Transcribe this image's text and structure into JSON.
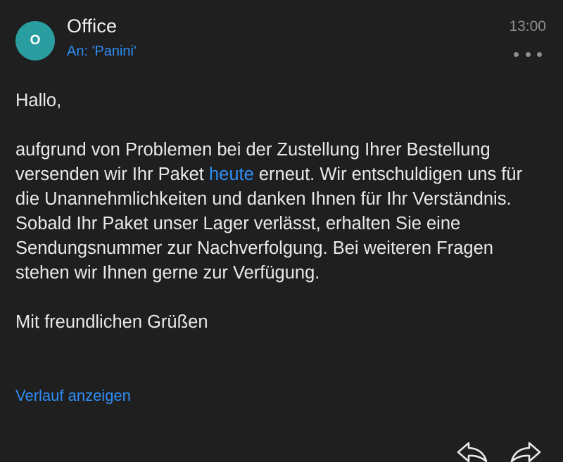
{
  "header": {
    "avatar_initial": "O",
    "sender_name": "Office",
    "recipient": "An: 'Panini'",
    "time": "13:00",
    "more_icon": "more-options-icon"
  },
  "message": {
    "greeting": "Hallo,",
    "para1_before_link": "aufgrund von Problemen bei der Zustellung Ihrer Bestellung versenden wir Ihr Paket ",
    "para1_link": "heute",
    "para1_after_link": " erneut. Wir entschuldigen uns für die Unannehmlichkeiten und danken Ihnen für Ihr Verständnis.",
    "para2": "Sobald Ihr Paket unser Lager verlässt, erhalten Sie eine Sendungsnummer zur Nachverfolgung. Bei weiteren Fragen stehen wir Ihnen gerne zur Verfügung.",
    "closing": "Mit freundlichen Grüßen"
  },
  "footer": {
    "show_history_label": "Verlauf anzeigen",
    "reply_icon": "reply-icon",
    "forward_icon": "forward-icon"
  },
  "colors": {
    "background": "#1f1f1f",
    "text": "#e9e9eb",
    "accent_link": "#2f8df5",
    "avatar": "#2a9da0",
    "secondary": "#8e8e93"
  }
}
